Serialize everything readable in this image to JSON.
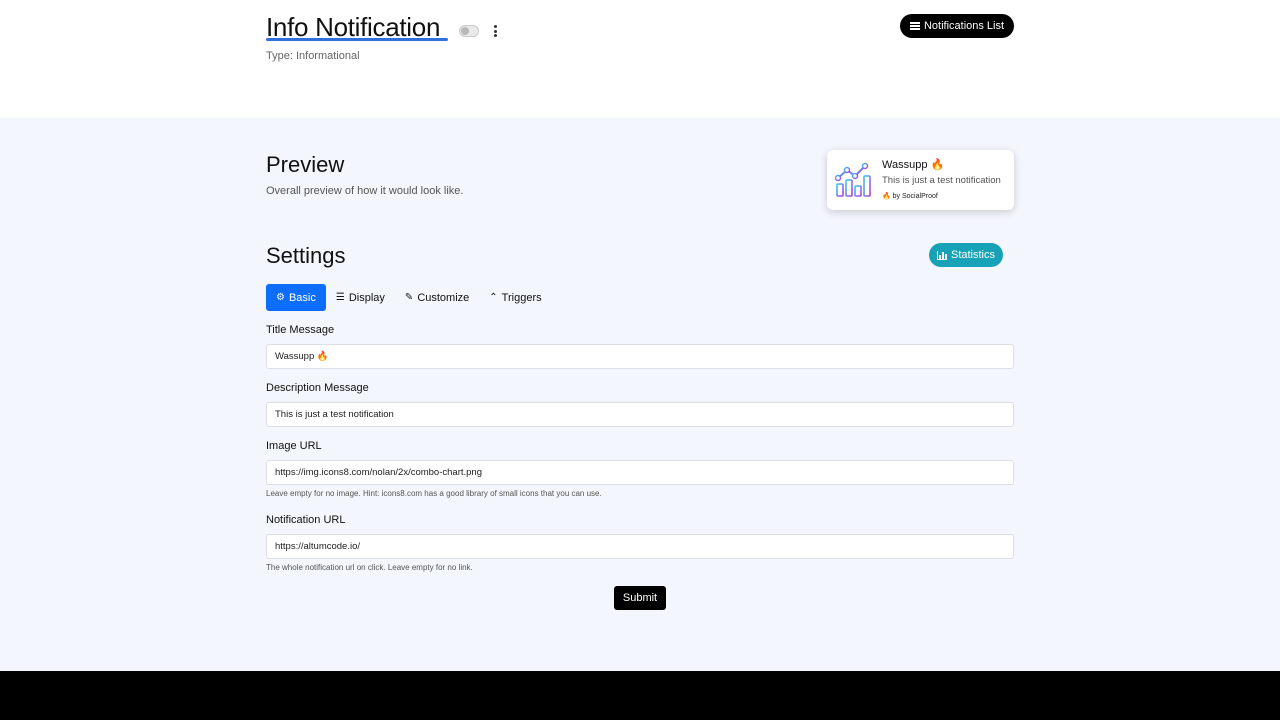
{
  "header": {
    "title": "Info Notification",
    "type_line": "Type: Informational",
    "notifications_list_label": "Notifications List"
  },
  "preview": {
    "heading": "Preview",
    "subheading": "Overall preview of how it would look like.",
    "card": {
      "title": "Wassupp 🔥",
      "description": "This is just a test notification",
      "branding": "🔥 by SocialProof"
    }
  },
  "settings": {
    "heading": "Settings",
    "statistics_label": "Statistics",
    "tabs": [
      {
        "label": "Basic",
        "icon": "gear-icon",
        "active": true
      },
      {
        "label": "Display",
        "icon": "list-icon",
        "active": false
      },
      {
        "label": "Customize",
        "icon": "paintbrush-icon",
        "active": false
      },
      {
        "label": "Triggers",
        "icon": "chevron-up-icon",
        "active": false
      }
    ],
    "fields": {
      "title_label": "Title Message",
      "title_value": "Wassupp 🔥",
      "description_label": "Description Message",
      "description_value": "This is just a test notification",
      "image_label": "Image URL",
      "image_value": "https://img.icons8.com/nolan/2x/combo-chart.png",
      "image_help": "Leave empty for no image. Hint: icons8.com has a good library of small icons that you can use.",
      "url_label": "Notification URL",
      "url_value": "https://altumcode.io/",
      "url_help": "The whole notification url on click. Leave empty for no link."
    },
    "submit_label": "Submit"
  },
  "colors": {
    "primary": "#0d6efd",
    "info": "#17a2b8",
    "dark": "#000000",
    "page_bg": "#f3f6fc"
  }
}
